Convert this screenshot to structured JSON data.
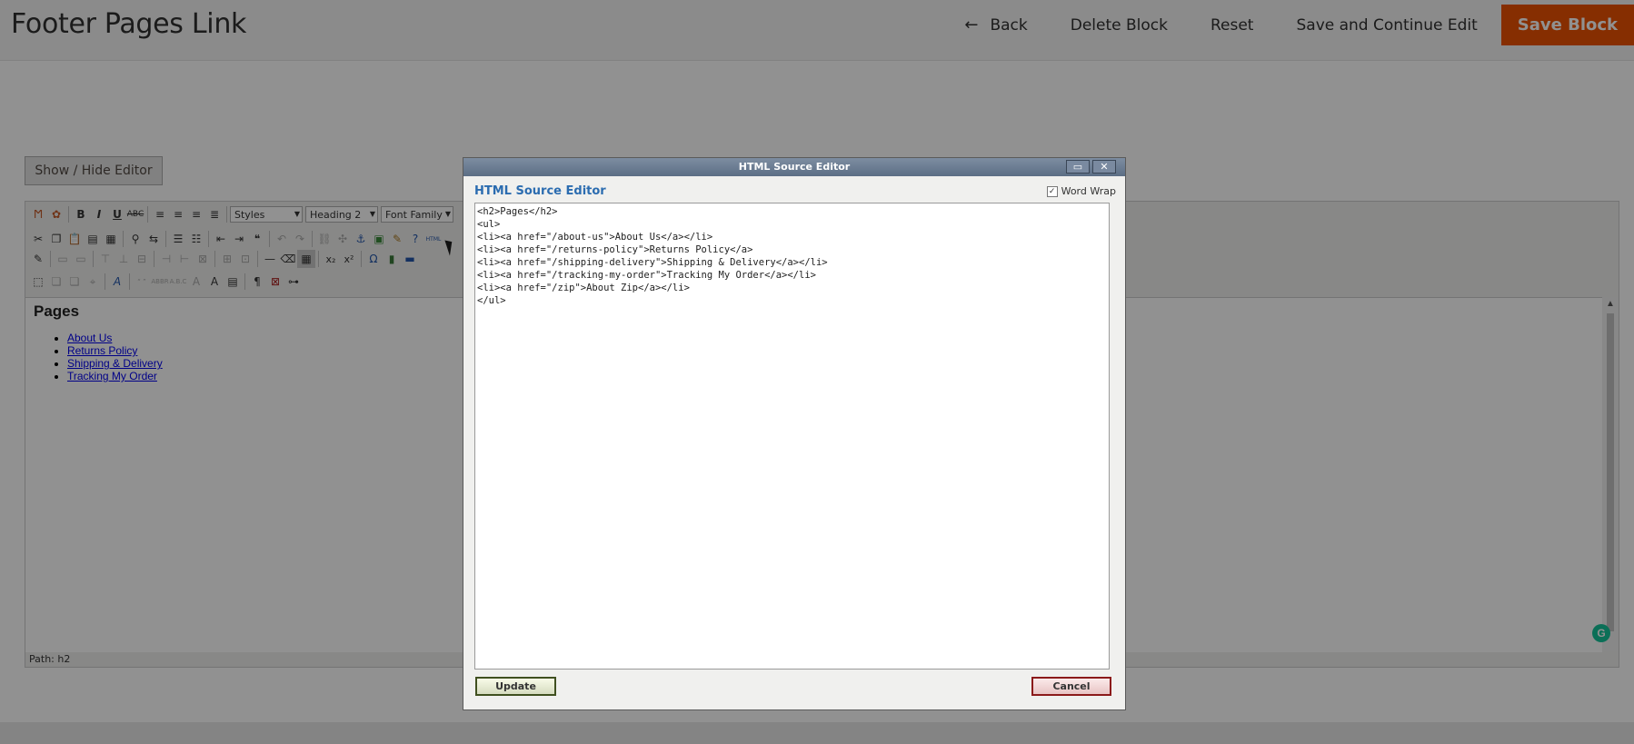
{
  "header": {
    "title": "Footer Pages Link",
    "back_label": "Back",
    "delete_label": "Delete Block",
    "reset_label": "Reset",
    "save_continue_label": "Save and Continue Edit",
    "save_label": "Save Block"
  },
  "editor": {
    "show_hide_label": "Show / Hide Editor",
    "styles_select": "Styles",
    "format_select": "Heading 2",
    "font_family_select": "Font Family",
    "path_label": "Path: h2",
    "content_heading": "Pages",
    "content_links": [
      "About Us",
      "Returns Policy",
      "Shipping & Delivery",
      "Tracking My Order"
    ]
  },
  "dialog": {
    "window_title": "HTML Source Editor",
    "heading": "HTML Source Editor",
    "word_wrap_label": "Word Wrap",
    "word_wrap_checked": true,
    "source_lines": [
      "<h2>Pages</h2>",
      "<ul>",
      "<li><a href=\"/about-us\">About Us</a></li>",
      "<li><a href=\"/returns-policy\">Returns Policy</a>",
      "<li><a href=\"/shipping-delivery\">Shipping & Delivery</a></li>",
      "<li><a href=\"/tracking-my-order\">Tracking My Order</a></li>",
      "<li><a href=\"/zip\">About Zip</a></li>",
      "</ul>"
    ],
    "update_label": "Update",
    "cancel_label": "Cancel"
  },
  "colors": {
    "accent": "#eb5202",
    "dialog_heading": "#2b6cb0",
    "link": "#0000ee"
  }
}
